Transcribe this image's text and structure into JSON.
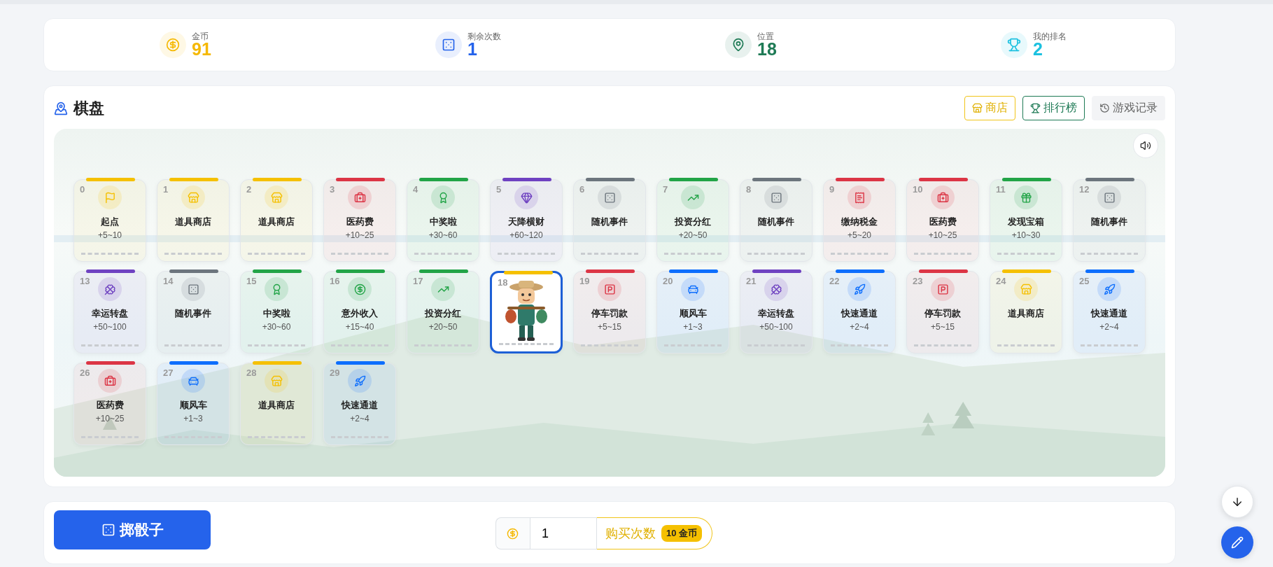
{
  "stats": [
    {
      "kind": "coins",
      "label": "金币",
      "value": "91",
      "color": "#f5b800"
    },
    {
      "kind": "rolls",
      "label": "剩余次数",
      "value": "1",
      "color": "#2563eb"
    },
    {
      "kind": "position",
      "label": "位置",
      "value": "18",
      "color": "#1e7a55"
    },
    {
      "kind": "rank",
      "label": "我的排名",
      "value": "2",
      "color": "#1cc1e0"
    }
  ],
  "board": {
    "title": "棋盘",
    "buttons": [
      {
        "kind": "shop",
        "label": "商店"
      },
      {
        "kind": "ranking",
        "label": "排行榜"
      },
      {
        "kind": "history",
        "label": "游戏记录"
      }
    ],
    "tiles": [
      {
        "number": "0",
        "kind": "start",
        "name": "起点",
        "range": "+5~10",
        "color": "#f5c000",
        "selected": false
      },
      {
        "number": "1",
        "kind": "shop",
        "name": "道具商店",
        "color": "#f5c000",
        "selected": false
      },
      {
        "number": "2",
        "kind": "shop",
        "name": "道具商店",
        "color": "#f5c000",
        "selected": false
      },
      {
        "number": "3",
        "kind": "medical",
        "name": "医药费",
        "range": "+10~25",
        "color": "#dc3545",
        "selected": false
      },
      {
        "number": "4",
        "kind": "prize",
        "name": "中奖啦",
        "range": "+30~60",
        "color": "#22a447",
        "selected": false
      },
      {
        "number": "5",
        "kind": "gem",
        "name": "天降横财",
        "range": "+60~120",
        "color": "#6f42c1",
        "selected": false
      },
      {
        "number": "6",
        "kind": "random",
        "name": "随机事件",
        "color": "#6c757d",
        "selected": false
      },
      {
        "number": "7",
        "kind": "invest",
        "name": "投资分红",
        "range": "+20~50",
        "color": "#22a447",
        "selected": false
      },
      {
        "number": "8",
        "kind": "random",
        "name": "随机事件",
        "color": "#6c757d",
        "selected": false
      },
      {
        "number": "9",
        "kind": "tax",
        "name": "缴纳税金",
        "range": "+5~20",
        "color": "#dc3545",
        "selected": false
      },
      {
        "number": "10",
        "kind": "medical",
        "name": "医药费",
        "range": "+10~25",
        "color": "#dc3545",
        "selected": false
      },
      {
        "number": "11",
        "kind": "gift",
        "name": "发现宝箱",
        "range": "+10~30",
        "color": "#22a447",
        "selected": false
      },
      {
        "number": "12",
        "kind": "random",
        "name": "随机事件",
        "color": "#6c757d",
        "selected": false
      },
      {
        "number": "13",
        "kind": "wheel",
        "name": "幸运转盘",
        "range": "+50~100",
        "color": "#6f42c1",
        "selected": false
      },
      {
        "number": "14",
        "kind": "random",
        "name": "随机事件",
        "color": "#6c757d",
        "selected": false
      },
      {
        "number": "15",
        "kind": "prize",
        "name": "中奖啦",
        "range": "+30~60",
        "color": "#22a447",
        "selected": false
      },
      {
        "number": "16",
        "kind": "income",
        "name": "意外收入",
        "range": "+15~40",
        "color": "#22a447",
        "selected": false
      },
      {
        "number": "17",
        "kind": "invest",
        "name": "投资分红",
        "range": "+20~50",
        "color": "#22a447",
        "selected": false
      },
      {
        "number": "18",
        "kind": "shop",
        "color": "#f5c000",
        "selected": true
      },
      {
        "number": "19",
        "kind": "parking",
        "name": "停车罚款",
        "range": "+5~15",
        "color": "#dc3545",
        "selected": false
      },
      {
        "number": "20",
        "kind": "car",
        "name": "顺风车",
        "range": "+1~3",
        "color": "#0d6efd",
        "selected": false
      },
      {
        "number": "21",
        "kind": "wheel",
        "name": "幸运转盘",
        "range": "+50~100",
        "color": "#6f42c1",
        "selected": false
      },
      {
        "number": "22",
        "kind": "rocket",
        "name": "快速通道",
        "range": "+2~4",
        "color": "#0d6efd",
        "selected": false
      },
      {
        "number": "23",
        "kind": "parking",
        "name": "停车罚款",
        "range": "+5~15",
        "color": "#dc3545",
        "selected": false
      },
      {
        "number": "24",
        "kind": "shop",
        "name": "道具商店",
        "color": "#f5c000",
        "selected": false
      },
      {
        "number": "25",
        "kind": "rocket",
        "name": "快速通道",
        "range": "+2~4",
        "color": "#0d6efd",
        "selected": false
      },
      {
        "number": "26",
        "kind": "medical",
        "name": "医药费",
        "range": "+10~25",
        "color": "#dc3545",
        "selected": false
      },
      {
        "number": "27",
        "kind": "car",
        "name": "顺风车",
        "range": "+1~3",
        "color": "#0d6efd",
        "selected": false
      },
      {
        "number": "28",
        "kind": "shop",
        "name": "道具商店",
        "color": "#f5c000",
        "selected": false
      },
      {
        "number": "29",
        "kind": "rocket",
        "name": "快速通道",
        "range": "+2~4",
        "color": "#0d6efd",
        "selected": false
      }
    ]
  },
  "actions": {
    "roll_button": "掷骰子",
    "quantity": "1",
    "buy_button": "购买次数",
    "price": "10 金币"
  }
}
